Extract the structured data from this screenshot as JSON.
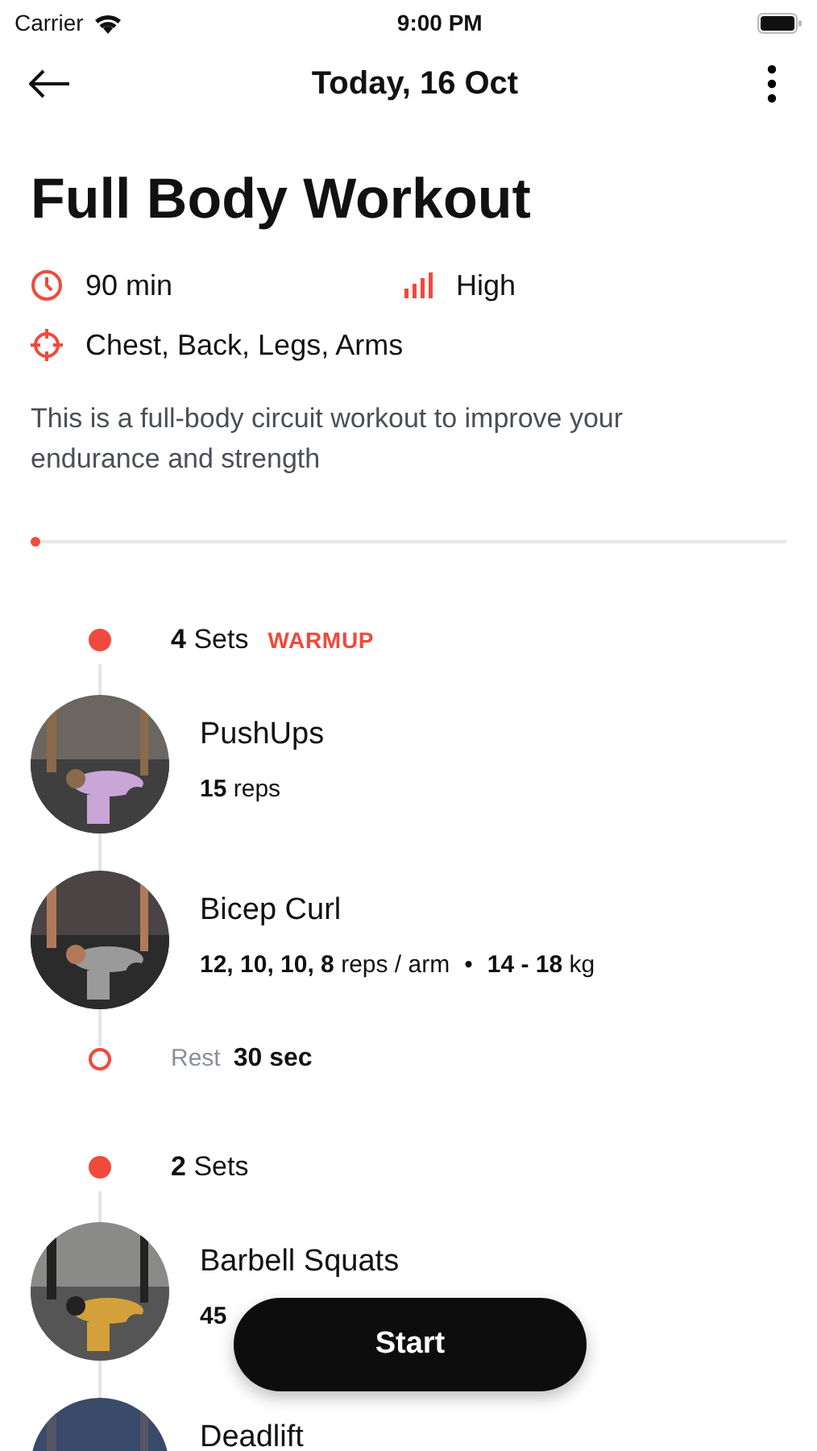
{
  "status_bar": {
    "carrier": "Carrier",
    "time": "9:00 PM"
  },
  "header": {
    "title": "Today, 16 Oct"
  },
  "workout": {
    "title": "Full Body Workout",
    "duration": "90 min",
    "intensity": "High",
    "muscles": "Chest, Back, Legs, Arms",
    "description": "This is a full-body circuit workout to improve your endurance and strength"
  },
  "progress": {
    "level": 0
  },
  "timeline": [
    {
      "kind": "sets",
      "label": "**4** Sets",
      "tag": "WARMUP"
    },
    {
      "kind": "exercise",
      "name": "PushUps",
      "detail": "**15** reps"
    },
    {
      "kind": "exercise",
      "name": "Bicep Curl",
      "detail": "**12, 10, 10, 8** reps / arm",
      "extra": "**14 - 18** kg",
      "separator": "•"
    },
    {
      "kind": "rest",
      "label": "Rest",
      "value": "30 sec"
    },
    {
      "kind": "sets",
      "label": "**2** Sets"
    },
    {
      "kind": "exercise",
      "name": "Barbell Squats",
      "detail": "**45**"
    },
    {
      "kind": "exercise",
      "name": "Deadlift"
    }
  ],
  "start_button": {
    "label": "Start"
  }
}
